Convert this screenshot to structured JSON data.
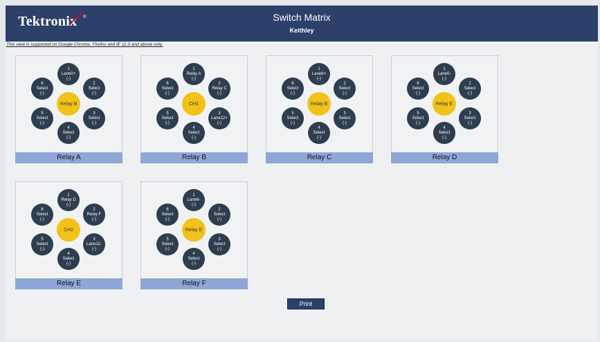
{
  "header": {
    "logo_text": "Tektronix",
    "logo_tm": "®",
    "title": "Switch Matrix",
    "subtitle": "Keithley"
  },
  "notice": "This view is supported on Google Chrome, Firefox and IE 11.0 and above only.",
  "colors": {
    "header": "#2c4069",
    "node": "#2e3d4f",
    "center": "#f2c21a",
    "label_bar": "#8ea6d8"
  },
  "panels": [
    {
      "label": "Relay A",
      "center": "Relay B",
      "nodes": [
        {
          "num": "1",
          "name": "Lane0+",
          "state": "(-)"
        },
        {
          "num": "2",
          "name": "Select",
          "state": "(-)"
        },
        {
          "num": "3",
          "name": "Select",
          "state": "(-)"
        },
        {
          "num": "4",
          "name": "Select",
          "state": "(-)"
        },
        {
          "num": "5",
          "name": "Select",
          "state": "(-)"
        },
        {
          "num": "6",
          "name": "Select",
          "state": "(-)"
        }
      ]
    },
    {
      "label": "Relay B",
      "center": "CH1",
      "nodes": [
        {
          "num": "1",
          "name": "Relay A",
          "state": "(-)"
        },
        {
          "num": "2",
          "name": "Relay C",
          "state": "(-)"
        },
        {
          "num": "3",
          "name": "Lane12+",
          "state": "(-)"
        },
        {
          "num": "4",
          "name": "Select",
          "state": "(-)"
        },
        {
          "num": "5",
          "name": "Select",
          "state": "(-)"
        },
        {
          "num": "6",
          "name": "Select",
          "state": "(-)"
        }
      ]
    },
    {
      "label": "Relay C",
      "center": "Relay B",
      "nodes": [
        {
          "num": "1",
          "name": "Lane6+",
          "state": "(-)"
        },
        {
          "num": "2",
          "name": "Select",
          "state": "(-)"
        },
        {
          "num": "3",
          "name": "Select",
          "state": "(-)"
        },
        {
          "num": "4",
          "name": "Select",
          "state": "(-)"
        },
        {
          "num": "5",
          "name": "Select",
          "state": "(-)"
        },
        {
          "num": "6",
          "name": "Select",
          "state": "(-)"
        }
      ]
    },
    {
      "label": "Relay D",
      "center": "Relay E",
      "nodes": [
        {
          "num": "1",
          "name": "Lane0-",
          "state": "(-)"
        },
        {
          "num": "2",
          "name": "Select",
          "state": "(-)"
        },
        {
          "num": "3",
          "name": "Select",
          "state": "(-)"
        },
        {
          "num": "4",
          "name": "Select",
          "state": "(-)"
        },
        {
          "num": "5",
          "name": "Select",
          "state": "(-)"
        },
        {
          "num": "6",
          "name": "Select",
          "state": "(-)"
        }
      ]
    },
    {
      "label": "Relay E",
      "center": "CH2",
      "nodes": [
        {
          "num": "1",
          "name": "Relay D",
          "state": "(-)"
        },
        {
          "num": "2",
          "name": "Relay F",
          "state": "(-)"
        },
        {
          "num": "3",
          "name": "Lane12-",
          "state": "(-)"
        },
        {
          "num": "4",
          "name": "Select",
          "state": "(-)"
        },
        {
          "num": "5",
          "name": "Select",
          "state": "(-)"
        },
        {
          "num": "6",
          "name": "Select",
          "state": "(-)"
        }
      ]
    },
    {
      "label": "Relay F",
      "center": "Relay E",
      "nodes": [
        {
          "num": "1",
          "name": "Lane6-",
          "state": "(-)"
        },
        {
          "num": "2",
          "name": "Select",
          "state": "(-)"
        },
        {
          "num": "3",
          "name": "Select",
          "state": "(-)"
        },
        {
          "num": "4",
          "name": "Select",
          "state": "(-)"
        },
        {
          "num": "5",
          "name": "Select",
          "state": "(-)"
        },
        {
          "num": "6",
          "name": "Select",
          "state": "(-)"
        }
      ]
    }
  ],
  "print_label": "Print"
}
